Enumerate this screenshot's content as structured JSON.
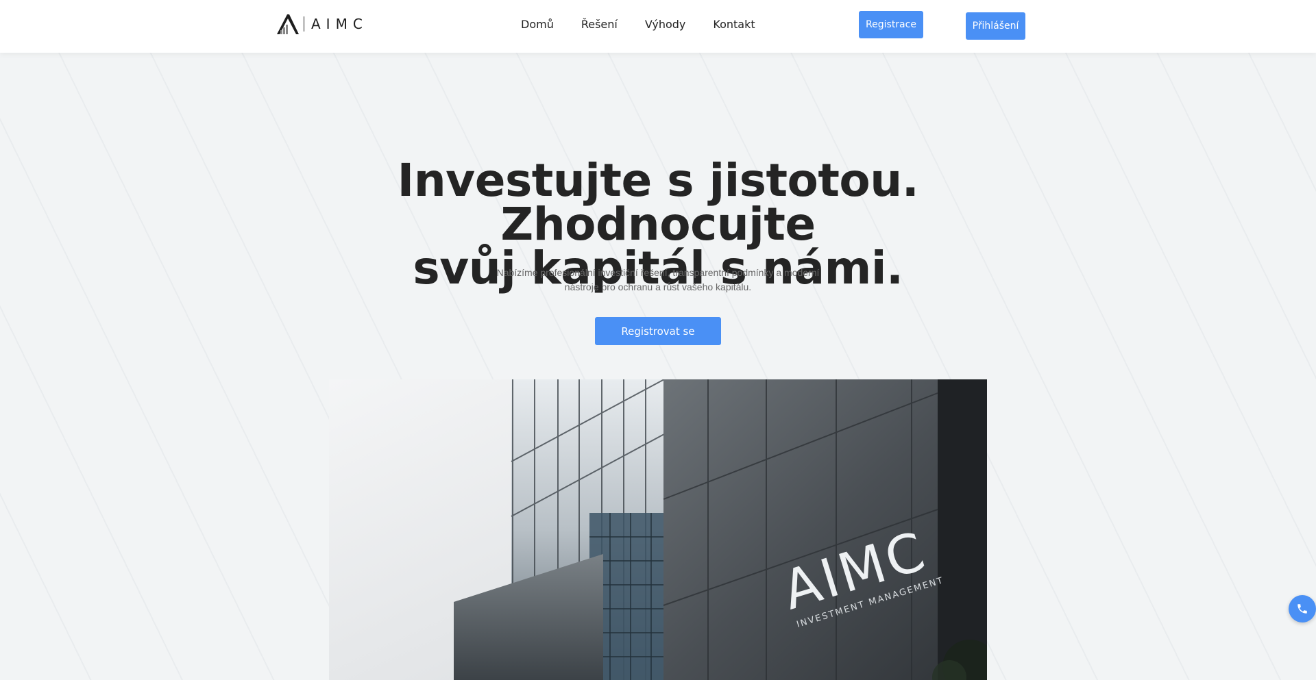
{
  "header": {
    "logo_text": "AIMC",
    "nav": [
      {
        "label": "Domů"
      },
      {
        "label": "Řešení"
      },
      {
        "label": "Výhody"
      },
      {
        "label": "Kontakt"
      }
    ],
    "register_label": "Registrace",
    "login_label": "Přihlášení"
  },
  "hero": {
    "title_line1": "Investujte s jistotou. Zhodnocujte",
    "title_line2": "svůj kapitál s námi.",
    "subtitle_line1": "Nabízíme profesionální investiční řešení, transparentní podmínky a moderní",
    "subtitle_line2": "nástroje pro ochranu a růst vašeho kapitálu.",
    "cta_label": "Registrovat se"
  },
  "image": {
    "sign_main": "AIMC",
    "sign_sub": "INVESTMENT MANAGEMENT"
  },
  "icons": {
    "phone": "phone-icon"
  },
  "colors": {
    "accent": "#4a90f5",
    "background": "#f2f4f5",
    "heading": "#242424"
  }
}
